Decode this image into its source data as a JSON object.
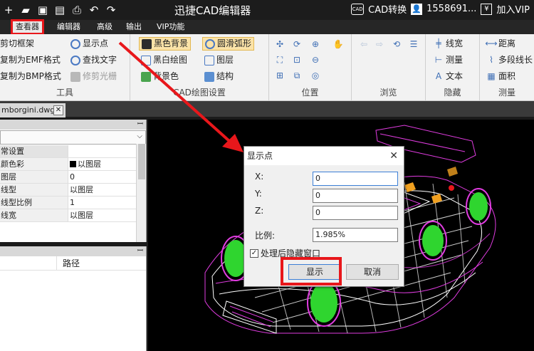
{
  "titlebar": {
    "app_title": "迅捷CAD编辑器",
    "cad_badge": "CAD",
    "cad_convert": "CAD转换",
    "user_phone": "1558691...",
    "yen_symbol": "¥",
    "join_vip": "加入VIP",
    "quick_icons": [
      "+",
      "▰",
      "▣",
      "▤",
      "⎙",
      "↶",
      "↷"
    ]
  },
  "menu": {
    "items": [
      "查看器",
      "编辑器",
      "高级",
      "输出",
      "VIP功能"
    ],
    "active": "查看器"
  },
  "ribbon": {
    "tools": {
      "label": "工具",
      "items": [
        "剪切框架",
        "复制为EMF格式",
        "复制为BMP格式",
        "显示点",
        "查找文字",
        "修剪光栅"
      ]
    },
    "cad_settings": {
      "label": "CAD绘图设置",
      "items": [
        "黑色背景",
        "圆滑弧形",
        "黑白绘图",
        "图层",
        "背景色",
        "结构"
      ]
    },
    "position": {
      "label": "位置"
    },
    "browse": {
      "label": "浏览"
    },
    "hide": {
      "label": "隐藏",
      "items": [
        "线宽",
        "测量",
        "文本"
      ]
    },
    "measure": {
      "label": "测量",
      "items": [
        "距离",
        "多段线长",
        "面积"
      ]
    }
  },
  "document_tab": {
    "name": "mborgini.dwg",
    "close": "✕"
  },
  "properties_panel": {
    "pin": "ꟷ",
    "rows": [
      {
        "key": "常设置",
        "value": ""
      },
      {
        "key": "颜色彩",
        "value": "以图层"
      },
      {
        "key": "图层",
        "value": "0"
      },
      {
        "key": "线型",
        "value": "以图层"
      },
      {
        "key": "线型比例",
        "value": "1"
      },
      {
        "key": "线宽",
        "value": "以图层"
      }
    ]
  },
  "path_panel": {
    "header": "",
    "column_path": "路径"
  },
  "dialog": {
    "title": "显示点",
    "close": "✕",
    "x_label": "X:",
    "y_label": "Y:",
    "z_label": "Z:",
    "x_value": "0",
    "y_value": "0",
    "z_value": "0",
    "scale_label": "比例:",
    "scale_value": "1.985%",
    "checkbox_label": "处理后隐藏窗口",
    "checkbox_checked": "✓",
    "show_button": "显示",
    "cancel_button": "取消"
  },
  "colors": {
    "annotation_red": "#e8171b",
    "wheel_green": "#2fd52f",
    "wire_magenta": "#e03ce0",
    "wire_white": "#ffffff",
    "accent_orange": "#f0a020"
  }
}
